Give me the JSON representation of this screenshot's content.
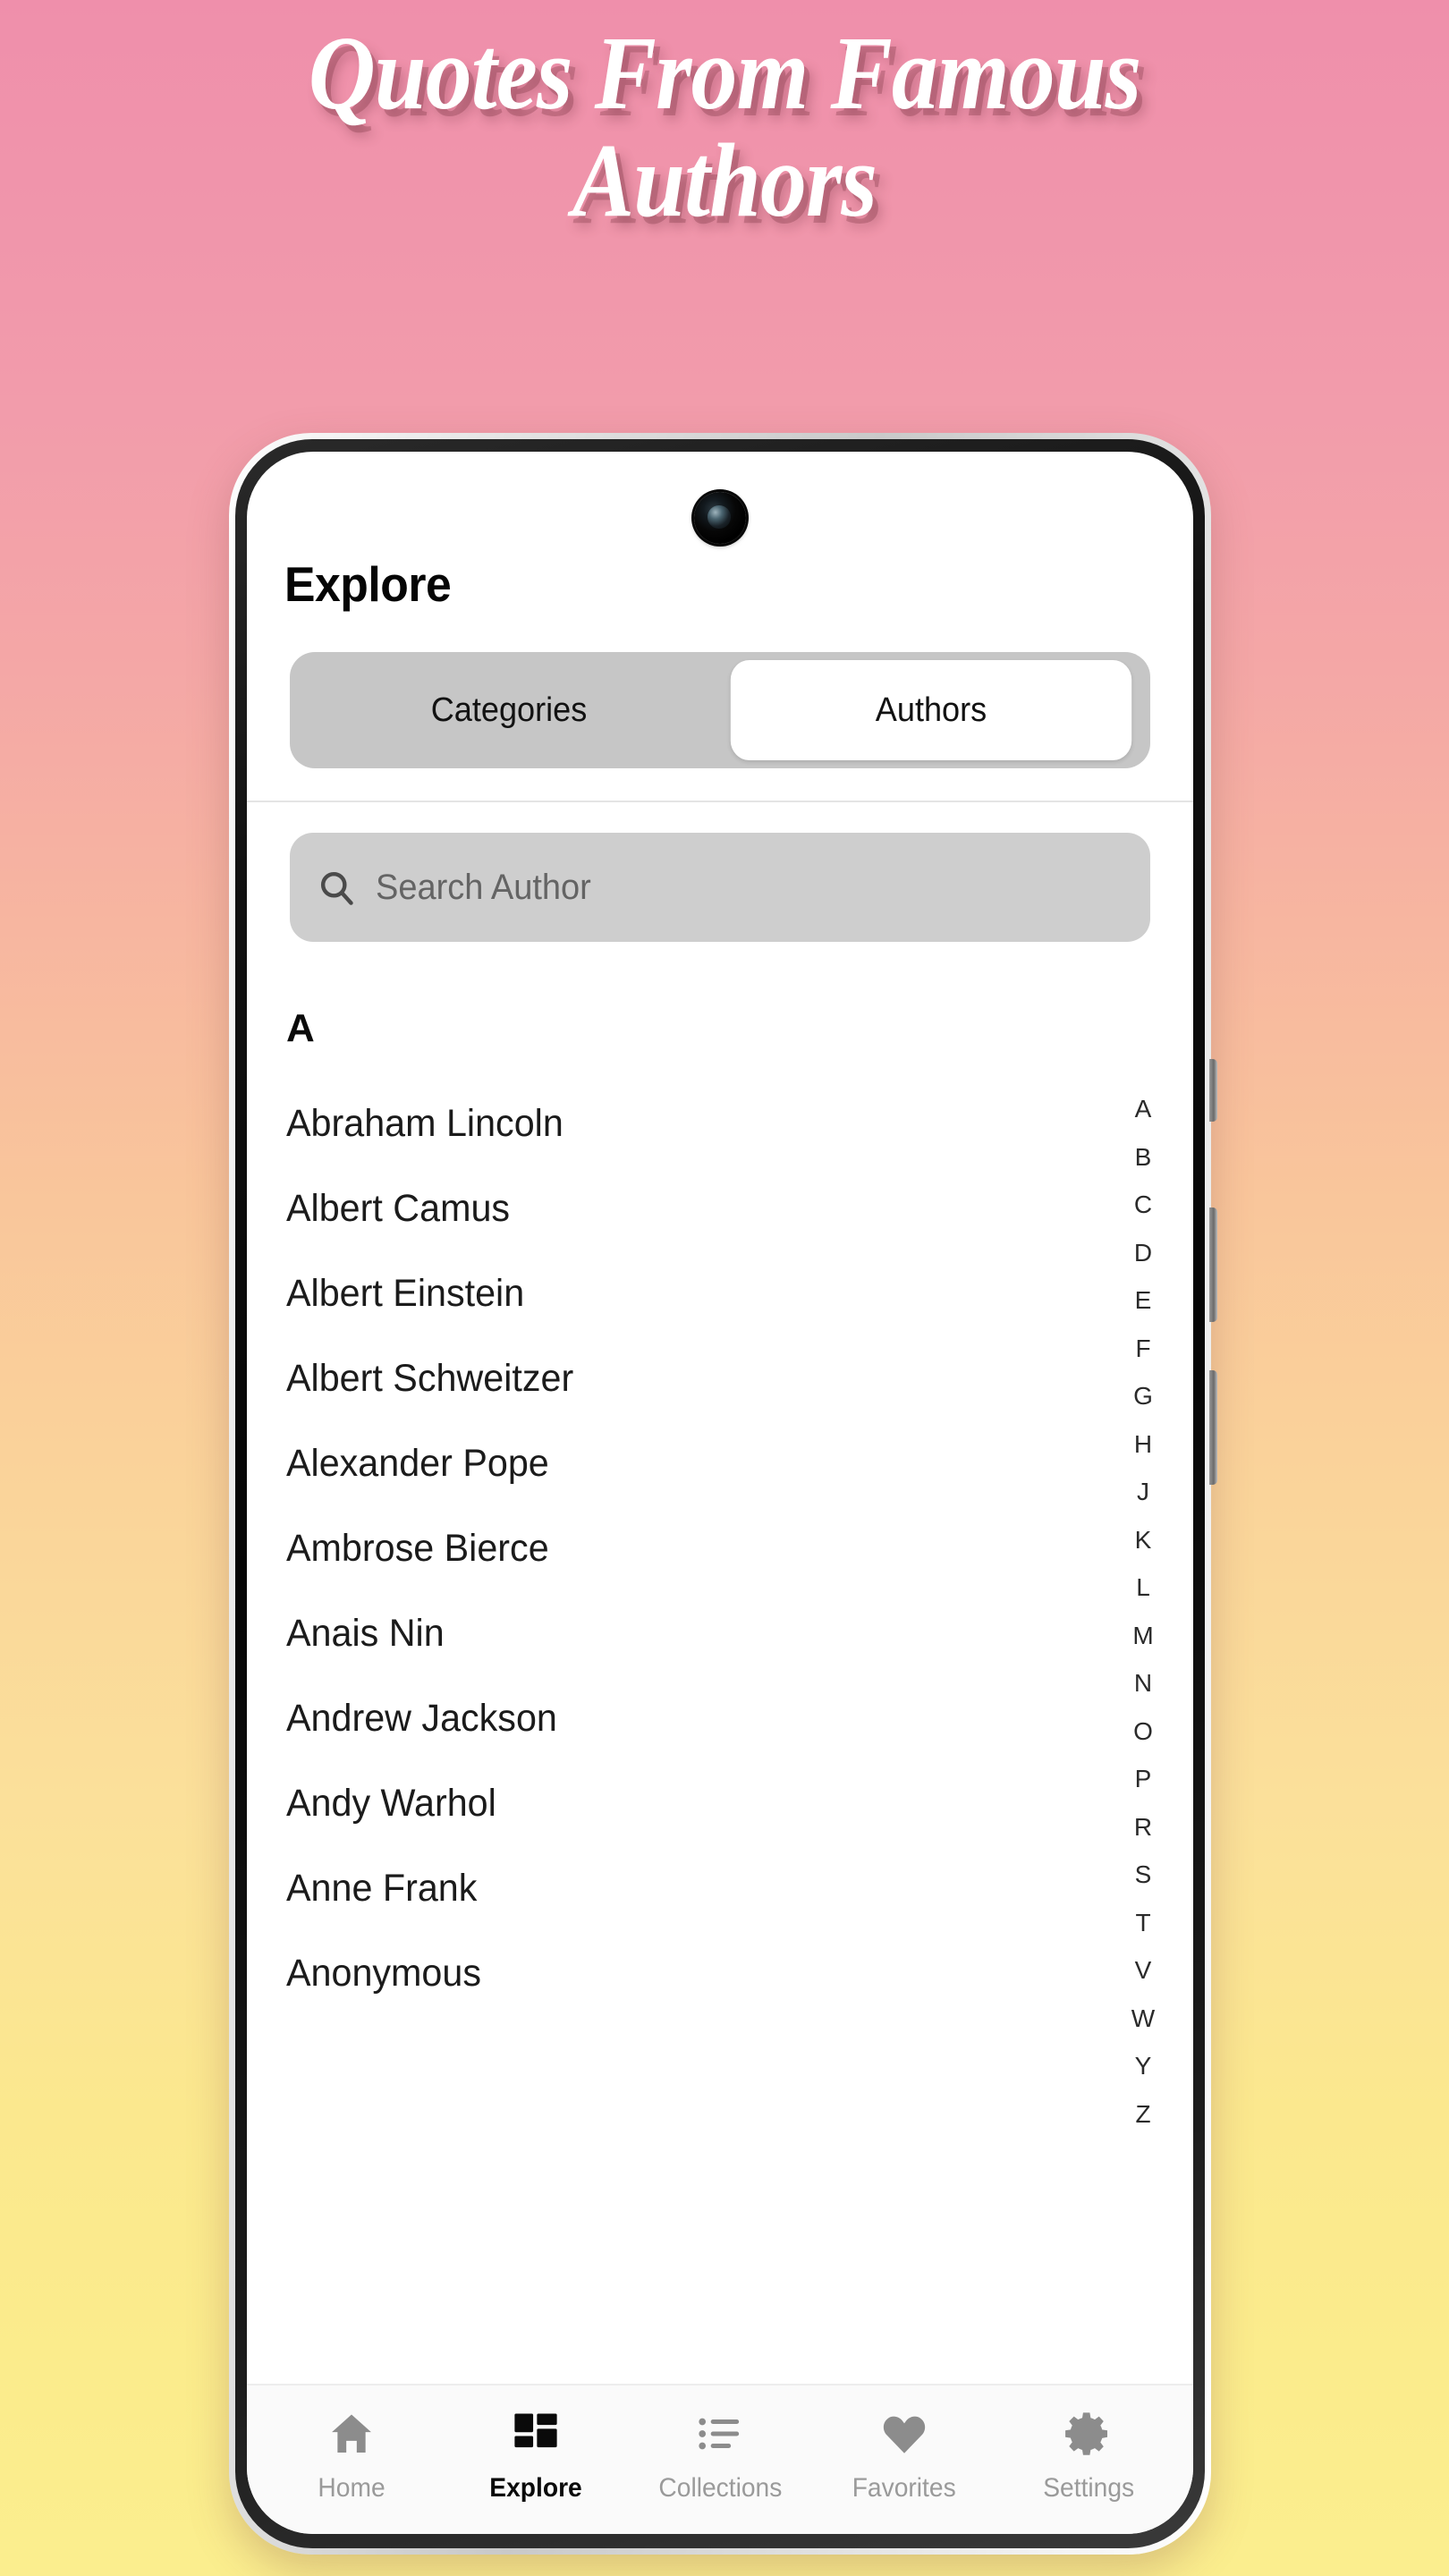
{
  "promo": {
    "title": "Quotes From Famous\nAuthors"
  },
  "app": {
    "page_title": "Explore",
    "segmented": {
      "options": [
        {
          "label": "Categories",
          "selected": false
        },
        {
          "label": "Authors",
          "selected": true
        }
      ]
    },
    "search": {
      "placeholder": "Search Author",
      "value": "",
      "icon": "search-icon"
    },
    "list": {
      "section_letter": "A",
      "authors": [
        "Abraham Lincoln",
        "Albert Camus",
        "Albert Einstein",
        "Albert Schweitzer",
        "Alexander Pope",
        "Ambrose Bierce",
        "Anais Nin",
        "Andrew Jackson",
        "Andy Warhol",
        "Anne Frank",
        "Anonymous"
      ]
    },
    "alphabet_index": [
      "A",
      "B",
      "C",
      "D",
      "E",
      "F",
      "G",
      "H",
      "J",
      "K",
      "L",
      "M",
      "N",
      "O",
      "P",
      "R",
      "S",
      "T",
      "V",
      "W",
      "Y",
      "Z"
    ],
    "bottom_nav": [
      {
        "label": "Home",
        "icon": "home-icon",
        "active": false
      },
      {
        "label": "Explore",
        "icon": "grid-icon",
        "active": true
      },
      {
        "label": "Collections",
        "icon": "list-icon",
        "active": false
      },
      {
        "label": "Favorites",
        "icon": "heart-icon",
        "active": false
      },
      {
        "label": "Settings",
        "icon": "gear-icon",
        "active": false
      }
    ]
  },
  "colors": {
    "background_top": "#ef8fab",
    "background_bottom": "#fbee8e",
    "title_text": "#ffffff",
    "segment_track": "#c6c6c6",
    "segment_selected": "#ffffff",
    "search_field": "#cecece",
    "search_placeholder": "#646464",
    "nav_inactive": "#8c8c8c",
    "nav_active": "#0a0a0a"
  }
}
